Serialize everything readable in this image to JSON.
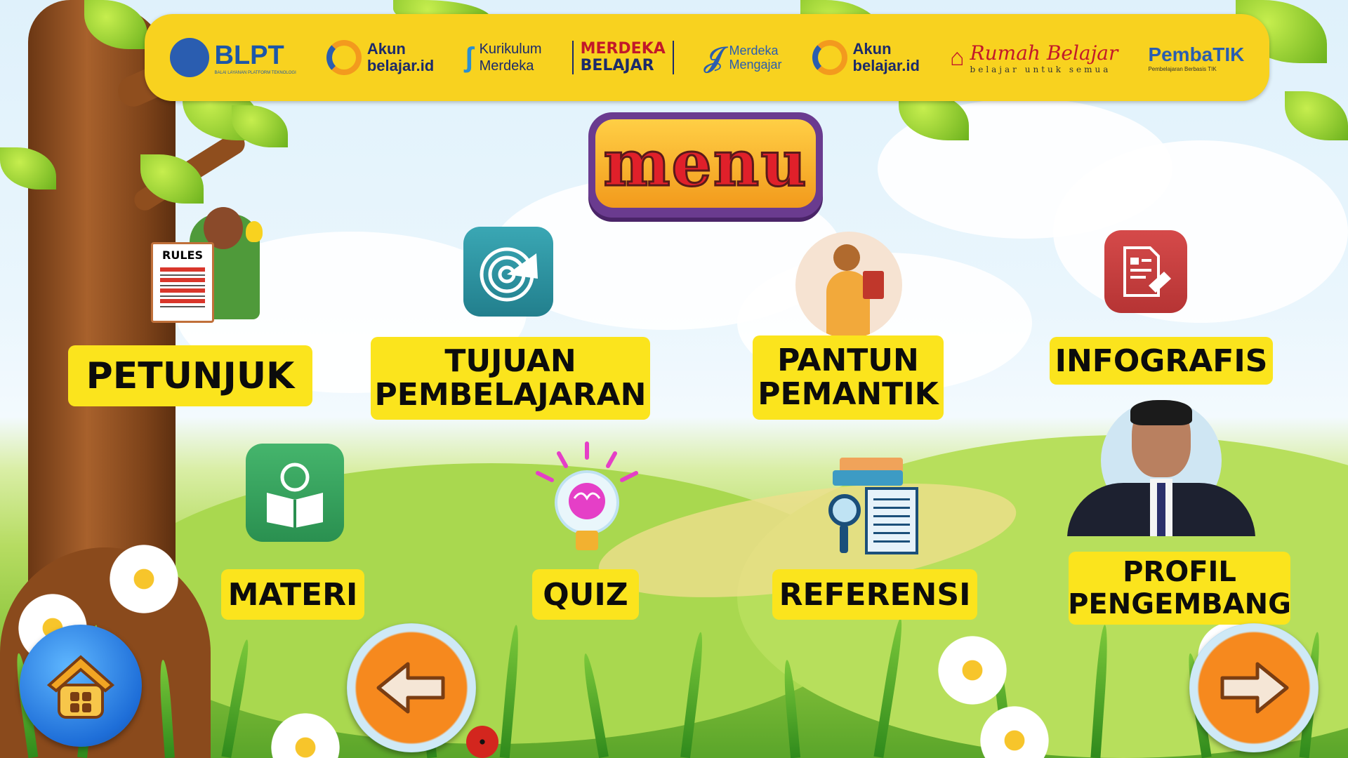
{
  "header": {
    "logos": {
      "blpt": {
        "name": "BLPT",
        "sub": "BALAI LAYANAN PLATFORM TEKNOLOGI"
      },
      "akun1": {
        "line1": "Akun",
        "line2": "belajar.id"
      },
      "kurikulum": {
        "line1": "Kurikulum",
        "line2": "Merdeka"
      },
      "merdeka_belajar": {
        "line1": "MERDEKA",
        "line2": "BELAJAR"
      },
      "merdeka_mengajar": {
        "line1": "Merdeka",
        "line2": "Mengajar"
      },
      "akun2": {
        "line1": "Akun",
        "line2": "belajar.id"
      },
      "rumah": {
        "title": "Rumah Belajar",
        "sub": "belajar untuk semua"
      },
      "pembatik": {
        "title": "PembaTIK",
        "sub": "Pembelajaran Berbasis TIK"
      }
    }
  },
  "title": "menu",
  "menu_items": {
    "petunjuk": "PETUNJUK",
    "tujuan": [
      "TUJUAN",
      "PEMBELAJARAN"
    ],
    "pantun": [
      "PANTUN",
      "PEMANTIK"
    ],
    "infografis": "INFOGRAFIS",
    "materi": "MATERI",
    "quiz": "QUIZ",
    "referensi": "REFERENSI",
    "profil": [
      "PROFIL",
      "PENGEMBANG"
    ]
  },
  "rules_board": "RULES",
  "icons": [
    "rules-board-icon",
    "radar-icon",
    "teacher-reading-icon",
    "document-edit-icon",
    "reader-icon",
    "brain-bulb-icon",
    "books-magnifier-icon",
    "developer-photo",
    "home-icon",
    "arrow-left-icon",
    "arrow-right-icon"
  ],
  "colors": {
    "label_bg": "#fbe41d",
    "header_bg": "#f8d21f",
    "menu_text": "#e0202a"
  }
}
